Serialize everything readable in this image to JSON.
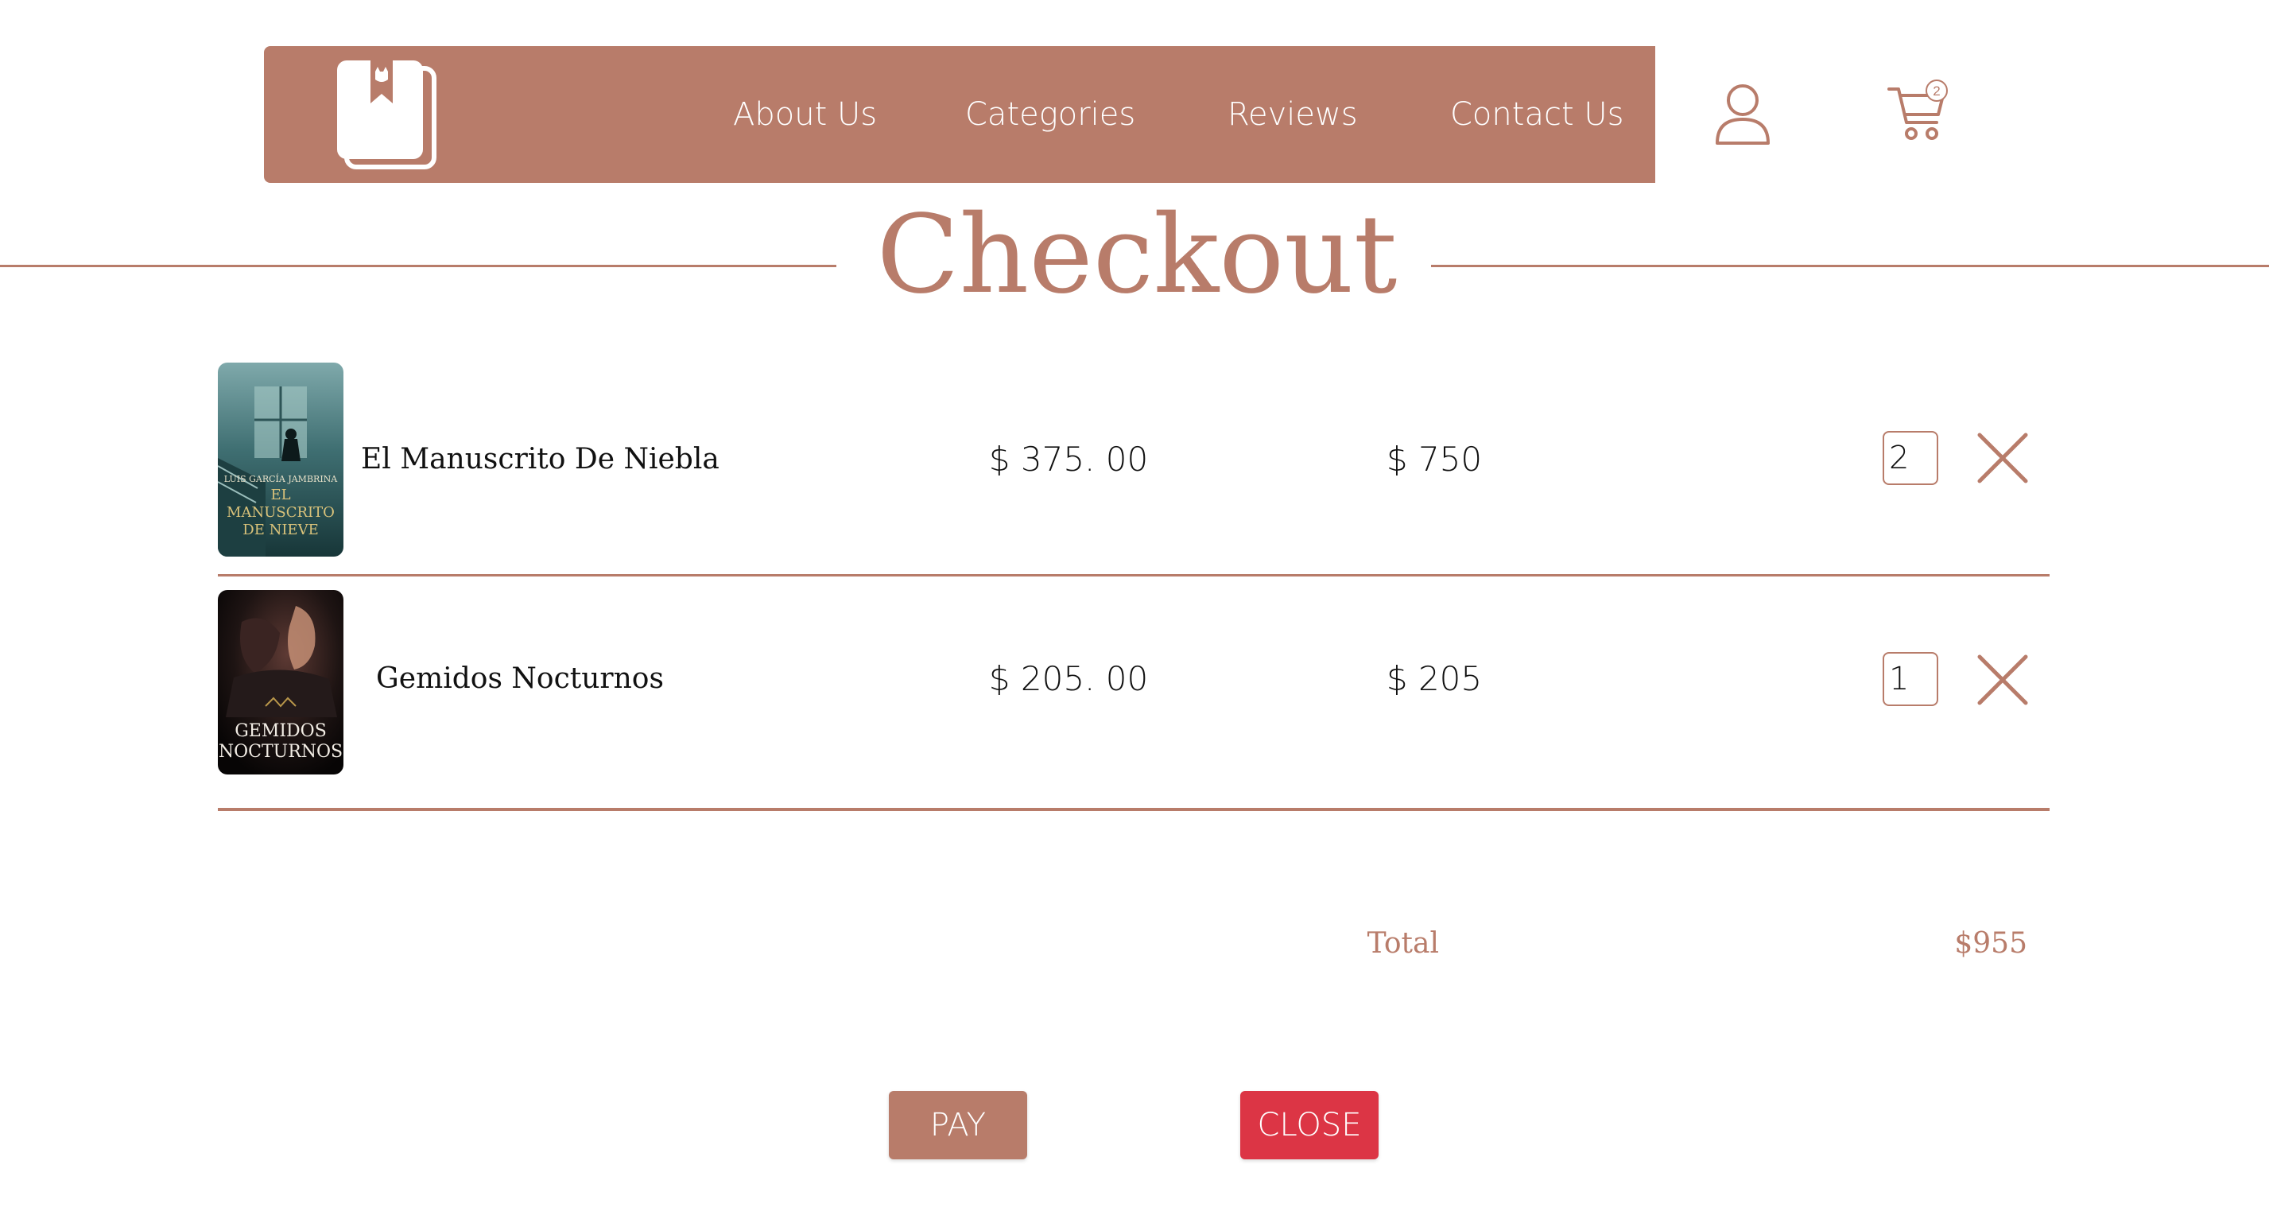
{
  "header": {
    "logo_icon": "book-with-bookmark-icon",
    "nav": [
      "About Us",
      "Categories",
      "Reviews",
      "Contact Us"
    ],
    "user_icon": "user-icon",
    "cart_icon": "cart-icon",
    "cart_count": "2"
  },
  "page": {
    "title": "Checkout"
  },
  "cart": {
    "items": [
      {
        "name": "El Manuscrito De Niebla",
        "price": "$ 375. 00",
        "subtotal": "$ 750",
        "quantity": "2",
        "cover": {
          "author": "LUIS GARCÍA JAMBRINA",
          "title_line1": "EL",
          "title_line2": "MANUSCRITO",
          "title_line3": "DE NIEVE"
        }
      },
      {
        "name": "Gemidos Nocturnos",
        "price": "$ 205. 00",
        "subtotal": "$ 205",
        "quantity": "1",
        "cover": {
          "title_line1": "GEMIDOS",
          "title_line2": "NOCTURNOS"
        }
      }
    ],
    "total_label": "Total",
    "total_value": "$955"
  },
  "actions": {
    "pay_label": "PAY",
    "close_label": "CLOSE"
  },
  "colors": {
    "brand": "#b87c6a",
    "danger": "#dc3545"
  }
}
